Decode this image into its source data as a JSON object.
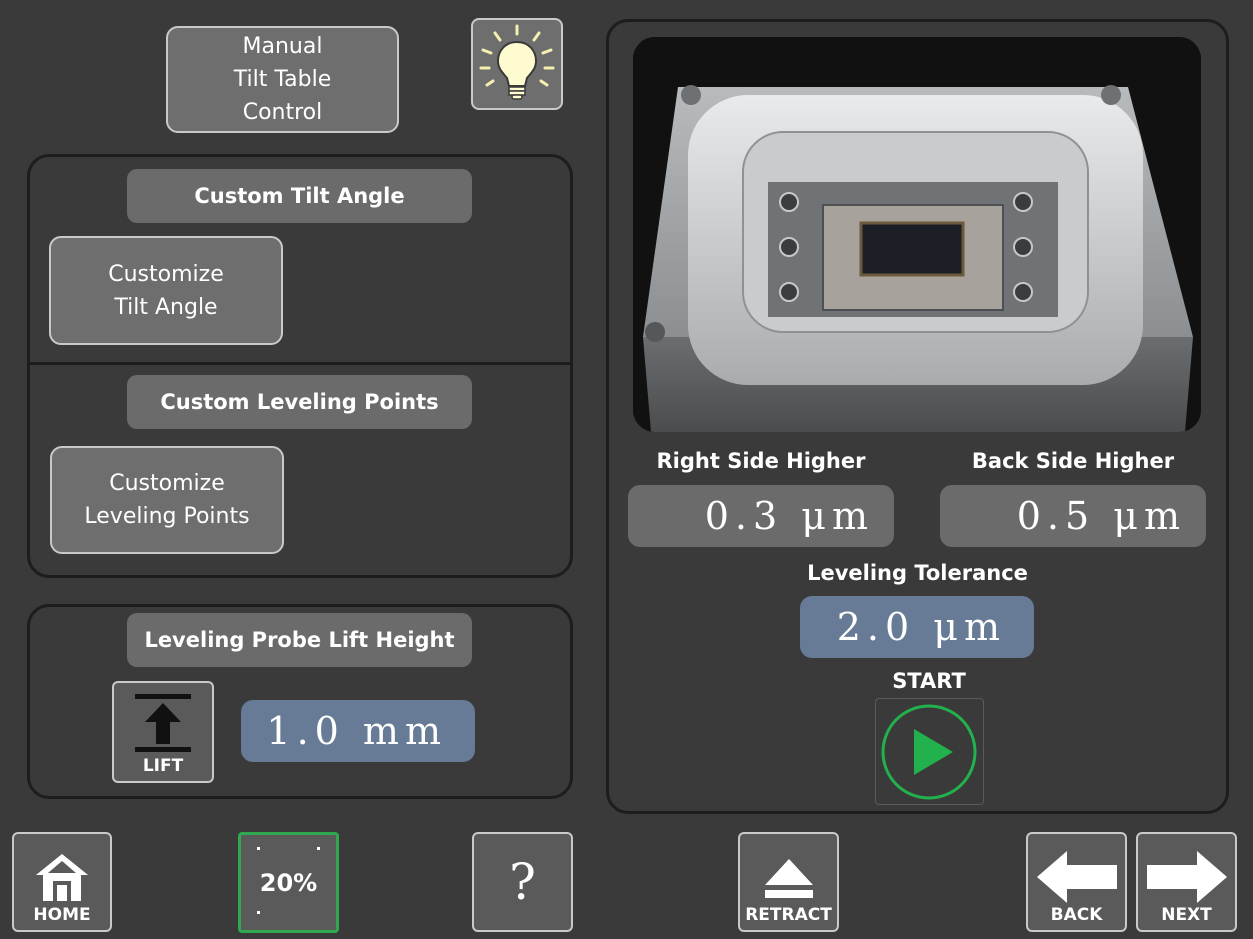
{
  "top": {
    "manual_button": "Manual\nTilt Table\nControl",
    "light_icon": "lightbulb-icon"
  },
  "tilt": {
    "header": "Custom Tilt Angle",
    "button": "Customize\nTilt Angle"
  },
  "points": {
    "header": "Custom Leveling Points",
    "button": "Customize\nLeveling Points"
  },
  "lift": {
    "header": "Leveling Probe Lift Height",
    "button_label": "LIFT",
    "value": "1.0 mm",
    "icon": "lift-arrow-icon"
  },
  "camera": {
    "image": "tilt-table-stage-photo"
  },
  "readouts": {
    "right_label": "Right Side Higher",
    "right_value": "0.3 μm",
    "back_label": "Back Side Higher",
    "back_value": "0.5 μm",
    "tolerance_label": "Leveling Tolerance",
    "tolerance_value": "2.0 μm"
  },
  "start": {
    "label": "START",
    "icon": "play-icon",
    "accent": "#22b14c"
  },
  "footer": {
    "home": "HOME",
    "zoom": "20%",
    "help": "?",
    "retract": "RETRACT",
    "back": "BACK",
    "next": "NEXT"
  },
  "colors": {
    "background": "#3a3a3a",
    "button": "#6e6e6e",
    "value_blue": "#677b96",
    "value_grey": "#6b6b6b",
    "zoom_border": "#2fa84f"
  }
}
